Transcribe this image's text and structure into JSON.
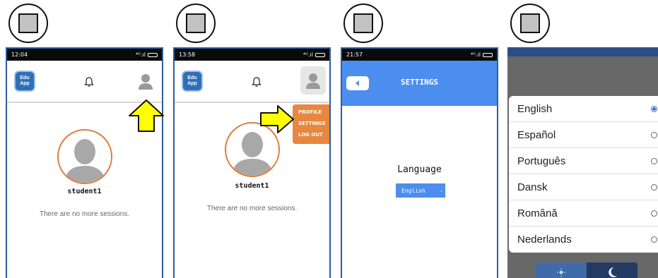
{
  "panels": [
    {
      "status": {
        "time": "12:04",
        "signal": "⁴ᴳ.ıl"
      },
      "logo": {
        "line1": "Edu",
        "line2": "App"
      },
      "profile": {
        "username": "student1",
        "message": "There are no more sessions."
      }
    },
    {
      "status": {
        "time": "13:58",
        "signal": "⁴ᴳ.ıl"
      },
      "logo": {
        "line1": "Edu",
        "line2": "App"
      },
      "menu": {
        "profile": "PROFILE",
        "settings": "SETTINGS",
        "logout": "LOG OUT"
      },
      "profile": {
        "username": "student1",
        "message": "There are no more sessions."
      }
    },
    {
      "status": {
        "time": "21:57",
        "signal": "⁴ᴳ.ıl"
      },
      "settings": {
        "title": "SETTINGS",
        "language_label": "Language",
        "language_value": "English"
      }
    },
    {
      "language_dialog": {
        "selected": "English",
        "options": [
          "English",
          "Español",
          "Português",
          "Dansk",
          "Română",
          "Nederlands"
        ]
      }
    }
  ],
  "colors": {
    "brand_blue": "#4c8df0",
    "accent_orange": "#e8873f",
    "arrow_yellow": "#ffff00",
    "radio_selected": "#3a6ad4"
  },
  "icons": [
    "bell-icon",
    "user-icon",
    "back-arrow-icon",
    "radio-icon",
    "sun-icon",
    "moon-icon",
    "highlight-arrow-icon"
  ]
}
